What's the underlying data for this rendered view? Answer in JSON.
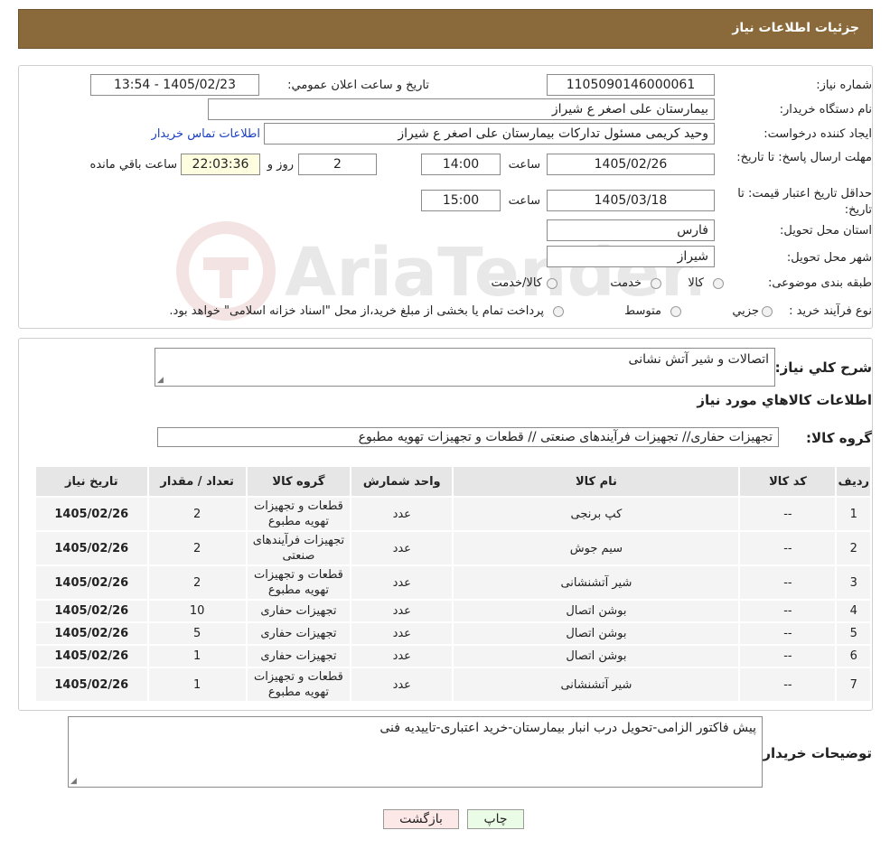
{
  "header": {
    "title": "جزئیات اطلاعات نیاز"
  },
  "form": {
    "need_number_label": "شماره نیاز:",
    "need_number": "1105090146000061",
    "announce_label": "تاريخ و ساعت اعلان عمومي:",
    "announce_value": "1405/02/23 - 13:54",
    "buyer_org_label": "نام دستگاه خريدار:",
    "buyer_org": "بیمارستان علی اصغر  ع  شیراز",
    "requester_label": "ايجاد کننده درخواست:",
    "requester": "وحید کریمی مسئول تدارکات بیمارستان علی اصغر  ع  شیراز",
    "contact_link": "اطلاعات تماس خريدار",
    "deadline_label": "مهلت ارسال پاسخ: تا تاريخ:",
    "deadline_date": "1405/02/26",
    "time_label": "ساعت",
    "deadline_time": "14:00",
    "days_value": "2",
    "days_label": "روز و",
    "remaining_value": "22:03:36",
    "remaining_label": "ساعت باقي مانده",
    "validity_label": "حداقل تاريخ اعتبار قيمت: تا تاريخ:",
    "validity_date": "1405/03/18",
    "validity_time": "15:00",
    "province_label": "استان محل تحويل:",
    "province": "فارس",
    "city_label": "شهر محل تحويل:",
    "city": "شیراز",
    "category_label": "طبقه بندی موضوعی:",
    "category_options": [
      "کالا",
      "خدمت",
      "کالا/خدمت"
    ],
    "process_label": "نوع فرآيند خريد :",
    "process_options": [
      "جزيي",
      "متوسط"
    ],
    "process_note": "پرداخت تمام یا بخشی از مبلغ خرید،از محل \"اسناد خزانه اسلامی\" خواهد بود."
  },
  "summary": {
    "label": "شرح كلي نياز:",
    "value": "اتصالات و شیر آتش نشانی",
    "goods_title": "اطلاعات كالاهاي مورد نياز",
    "group_label": "گروه كالا:",
    "group_value": "تجهیزات حفاری// تجهیزات فرآیندهای صنعتی //  قطعات و تجهیزات تهویه مطبوع"
  },
  "table": {
    "headers": [
      "رديف",
      "کد کالا",
      "نام کالا",
      "واحد شمارش",
      "گروه کالا",
      "تعداد / مقدار",
      "تاريخ نياز"
    ],
    "rows": [
      [
        "1",
        "--",
        "کپ برنجی",
        "عدد",
        "قطعات و تجهیزات تهویه مطبوع",
        "2",
        "1405/02/26"
      ],
      [
        "2",
        "--",
        "سیم جوش",
        "عدد",
        "تجهیزات فرآیندهای صنعتی",
        "2",
        "1405/02/26"
      ],
      [
        "3",
        "--",
        "شیر آتشنشانی",
        "عدد",
        "قطعات و تجهیزات تهویه مطبوع",
        "2",
        "1405/02/26"
      ],
      [
        "4",
        "--",
        "بوشن اتصال",
        "عدد",
        "تجهیزات حفاری",
        "10",
        "1405/02/26"
      ],
      [
        "5",
        "--",
        "بوشن اتصال",
        "عدد",
        "تجهیزات حفاری",
        "5",
        "1405/02/26"
      ],
      [
        "6",
        "--",
        "بوشن اتصال",
        "عدد",
        "تجهیزات حفاری",
        "1",
        "1405/02/26"
      ],
      [
        "7",
        "--",
        "شیر آتشنشانی",
        "عدد",
        "قطعات و تجهیزات تهویه مطبوع",
        "1",
        "1405/02/26"
      ]
    ]
  },
  "buyer_notes": {
    "label": "توضيحات خريدار:",
    "value": "پیش فاکتور الزامی-تحویل درب انبار بیمارستان-خرید اعتباری-تاییدیه فنی"
  },
  "buttons": {
    "print": "چاپ",
    "back": "بازگشت"
  },
  "watermark": {
    "text": "AriaTender.neT"
  },
  "colors": {
    "header_bg": "#8a6a3a",
    "link": "#1a3fc4",
    "back_button_bg": "#fde8e8",
    "print_button_bg": "#eafbe6"
  }
}
